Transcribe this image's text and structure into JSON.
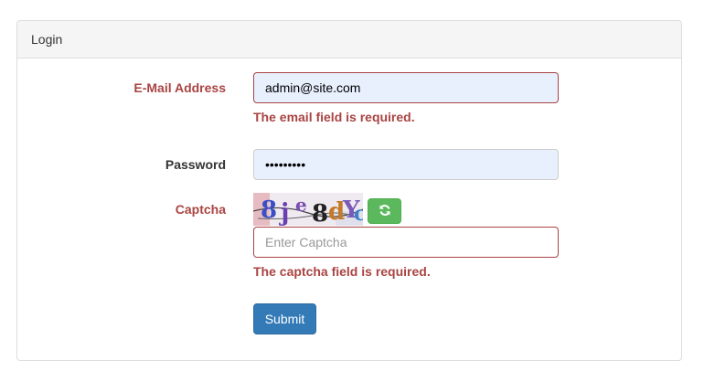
{
  "panel": {
    "title": "Login"
  },
  "form": {
    "email": {
      "label": "E-Mail Address",
      "value": "admin@site.com",
      "error": "The email field is required."
    },
    "password": {
      "label": "Password",
      "value": "•••••••••"
    },
    "captcha": {
      "label": "Captcha",
      "placeholder": "Enter Captcha",
      "error": "The captcha field is required.",
      "refresh_icon": "refresh-icon"
    },
    "submit_label": "Submit"
  },
  "colors": {
    "error": "#a94442",
    "primary": "#337ab7",
    "success": "#5cb85c",
    "autofill": "#e8f0fe"
  }
}
